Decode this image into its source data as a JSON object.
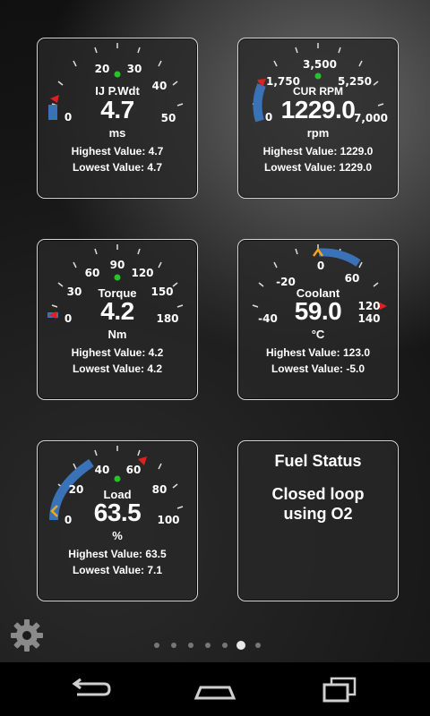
{
  "gauges": [
    {
      "id": "ij-pwdt",
      "label": "IJ P.Wdt",
      "value": "4.7",
      "unit": "ms",
      "highest": "Highest Value: 4.7",
      "lowest": "Lowest Value: 4.7",
      "ticks": [
        "0",
        "20",
        "30",
        "40",
        "50"
      ]
    },
    {
      "id": "cur-rpm",
      "label": "CUR RPM",
      "value": "1229.0",
      "unit": "rpm",
      "highest": "Highest Value: 1229.0",
      "lowest": "Lowest Value: 1229.0",
      "ticks": [
        "0",
        "1,750",
        "3,500",
        "5,250",
        "7,000"
      ]
    },
    {
      "id": "torque",
      "label": "Torque",
      "value": "4.2",
      "unit": "Nm",
      "highest": "Highest Value: 4.2",
      "lowest": "Lowest Value: 4.2",
      "ticks": [
        "0",
        "30",
        "60",
        "90",
        "120",
        "150",
        "180"
      ]
    },
    {
      "id": "coolant",
      "label": "Coolant",
      "value": "59.0",
      "unit": "°C",
      "highest": "Highest Value: 123.0",
      "lowest": "Lowest Value: -5.0",
      "ticks": [
        "-40",
        "-20",
        "0",
        "60",
        "120",
        "140"
      ]
    },
    {
      "id": "load",
      "label": "Load",
      "value": "63.5",
      "unit": "%",
      "highest": "Highest Value: 63.5",
      "lowest": "Lowest Value: 7.1",
      "ticks": [
        "0",
        "20",
        "40",
        "60",
        "80",
        "100"
      ]
    }
  ],
  "fuel": {
    "title": "Fuel Status",
    "status_line1": "Closed loop",
    "status_line2": "using O2"
  },
  "settings_icon": "gear-icon",
  "page_indicator": {
    "count": 7,
    "active_index": 5
  },
  "nav": {
    "back": "back-icon",
    "home": "home-icon",
    "recents": "recents-icon"
  },
  "colors": {
    "arc": "#3a72b8",
    "marker_red": "#e02020",
    "marker_orange": "#f4a51c",
    "center_dot": "#2cc12c",
    "tile_border": "#d7d7d7"
  }
}
